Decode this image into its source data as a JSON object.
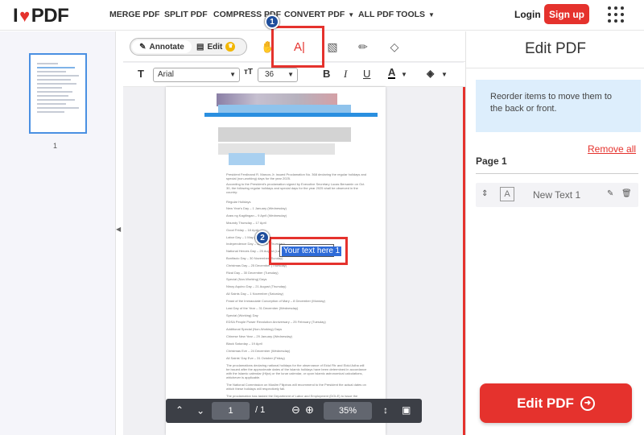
{
  "nav": {
    "logo_left": "I",
    "logo_right": "PDF",
    "items": [
      "MERGE PDF",
      "SPLIT PDF",
      "COMPRESS PDF",
      "CONVERT PDF",
      "ALL PDF TOOLS"
    ],
    "login": "Login",
    "signup": "Sign up"
  },
  "sidebar": {
    "page_number": "1"
  },
  "toolbar": {
    "annotate": "Annotate",
    "edit": "Edit",
    "font": "Arial",
    "font_size": "36",
    "tools": [
      "hand-icon",
      "add-text-icon",
      "image-icon",
      "pencil-icon",
      "shapes-icon"
    ]
  },
  "document": {
    "textbox_text": "Your text here 1",
    "paragraphs": [
      "President Ferdinand R. Marcos Jr. issued Proclamation No. 368 declaring the regular holidays and special (non-working) days for the year 2025.",
      "According to the President's proclamation signed by Executive Secretary Lucas Bersamin on Oct. 30, the following regular holidays and special days for the year 2025 shall be observed in the country:",
      "Regular Holidays",
      "New Year's Day – 1 January (Wednesday)",
      "Araw ng Kagitingan – 9 April (Wednesday)",
      "Maundy Thursday – 17 April",
      "Good Friday – 18 April",
      "Labor Day – 1 May (Thursday)",
      "Independence Day – 12 June (Thursday)",
      "National Heroes Day – 25 August (Last Monday of August)",
      "Bonifacio Day – 30 November (Sunday)",
      "Christmas Day – 25 December (Thursday)",
      "Rizal Day – 30 December (Tuesday)",
      "Special (Non-Working) Days",
      "Ninoy Aquino Day – 21 August (Thursday)",
      "All Saints Day – 1 November (Saturday)",
      "Feast of the Immaculate Conception of Mary – 8 December (Monday)",
      "Last Day of the Year – 31 December (Wednesday)",
      "Special (Working) Day",
      "EDSA People Power Revolution Anniversary – 25 February (Tuesday)",
      "Additional Special (Non-Working) Days",
      "Chinese New Year – 29 January (Wednesday)",
      "Black Saturday – 19 April",
      "Christmas Eve – 24 December (Wednesday)",
      "All Saints' Day Eve – 31 October (Friday)",
      "The proclamations declaring national holidays for the observance of Eidul Fitr and Eidul Adha will be issued after the approximate dates of the Islamic holidays have been determined in accordance with the Islamic calendar (Hijra) or the lunar calendar, or upon Islamic astronomical calculations, whichever is applicable.",
      "The National Commission on Muslim Filipinos will recommend to the President the actual dates on which these holidays will respectively fall.",
      "The proclamation has tasked the Department of Labor and Employment (DOLE) to issue the implementing guidelines for the proclamation, which is expected to take effect immediately."
    ]
  },
  "pager": {
    "current": "1",
    "total": "/ 1",
    "zoom": "35%"
  },
  "panel": {
    "title": "Edit PDF",
    "info": "Reorder items to move them to the back or front.",
    "remove_all": "Remove all",
    "page_label": "Page 1",
    "item_label": "New Text 1",
    "cta": "Edit PDF"
  },
  "annotations": {
    "badge1": "1",
    "badge2": "2"
  },
  "colors": {
    "brand": "#e5322d",
    "highlight": "#e5322d",
    "badge": "#1f4e9c",
    "selection": "#2e6bd8"
  }
}
